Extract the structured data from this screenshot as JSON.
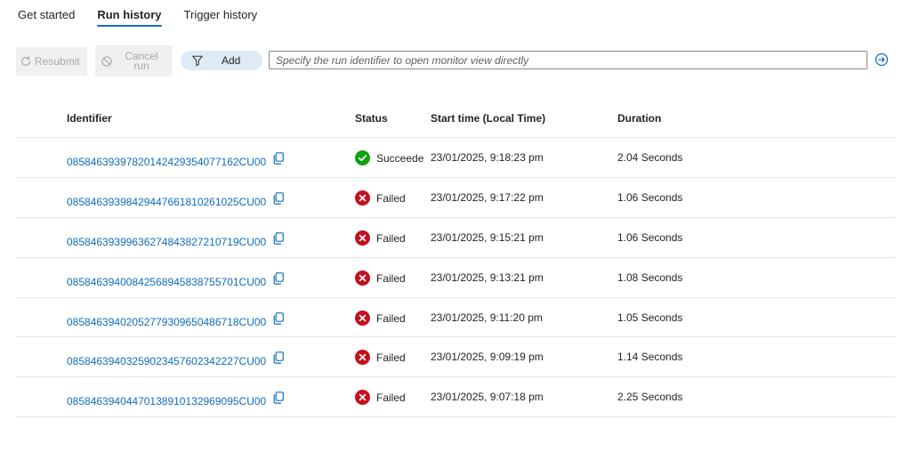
{
  "tabs": [
    {
      "label": "Get started",
      "active": false
    },
    {
      "label": "Run history",
      "active": true
    },
    {
      "label": "Trigger history",
      "active": false
    }
  ],
  "toolbar": {
    "resubmit_label": "Resubmit",
    "cancel_label_line1": "Cancel",
    "cancel_label_line2": "run",
    "filter_icon": "filter-icon",
    "add_label": "Add",
    "search_placeholder": "Specify the run identifier to open monitor view directly",
    "go_icon": "arrow-right-circle-icon"
  },
  "colors": {
    "accent": "#0f6cbd",
    "success": "#13a10e",
    "failed": "#c50f1f",
    "pill_bg": "#dfeaf7",
    "disabled_bg": "#f0f0f0"
  },
  "table": {
    "columns": [
      "Identifier",
      "Status",
      "Start time (Local Time)",
      "Duration"
    ],
    "rows": [
      {
        "id": "08584639397820142429354077162CU00",
        "status": "Succeeded",
        "status_icon": "check-circle-icon",
        "start": "23/01/2025, 9:18:23 pm",
        "duration": "2.04 Seconds"
      },
      {
        "id": "08584639398429447661810261025CU00",
        "status": "Failed",
        "status_icon": "x-circle-icon",
        "start": "23/01/2025, 9:17:22 pm",
        "duration": "1.06 Seconds"
      },
      {
        "id": "08584639399636274843827210719CU00",
        "status": "Failed",
        "status_icon": "x-circle-icon",
        "start": "23/01/2025, 9:15:21 pm",
        "duration": "1.06 Seconds"
      },
      {
        "id": "08584639400842568945838755701CU00",
        "status": "Failed",
        "status_icon": "x-circle-icon",
        "start": "23/01/2025, 9:13:21 pm",
        "duration": "1.08 Seconds"
      },
      {
        "id": "08584639402052779309650486718CU00",
        "status": "Failed",
        "status_icon": "x-circle-icon",
        "start": "23/01/2025, 9:11:20 pm",
        "duration": "1.05 Seconds"
      },
      {
        "id": "08584639403259023457602342227CU00",
        "status": "Failed",
        "status_icon": "x-circle-icon",
        "start": "23/01/2025, 9:09:19 pm",
        "duration": "1.14 Seconds"
      },
      {
        "id": "08584639404470138910132969095CU00",
        "status": "Failed",
        "status_icon": "x-circle-icon",
        "start": "23/01/2025, 9:07:18 pm",
        "duration": "2.25 Seconds"
      }
    ]
  }
}
